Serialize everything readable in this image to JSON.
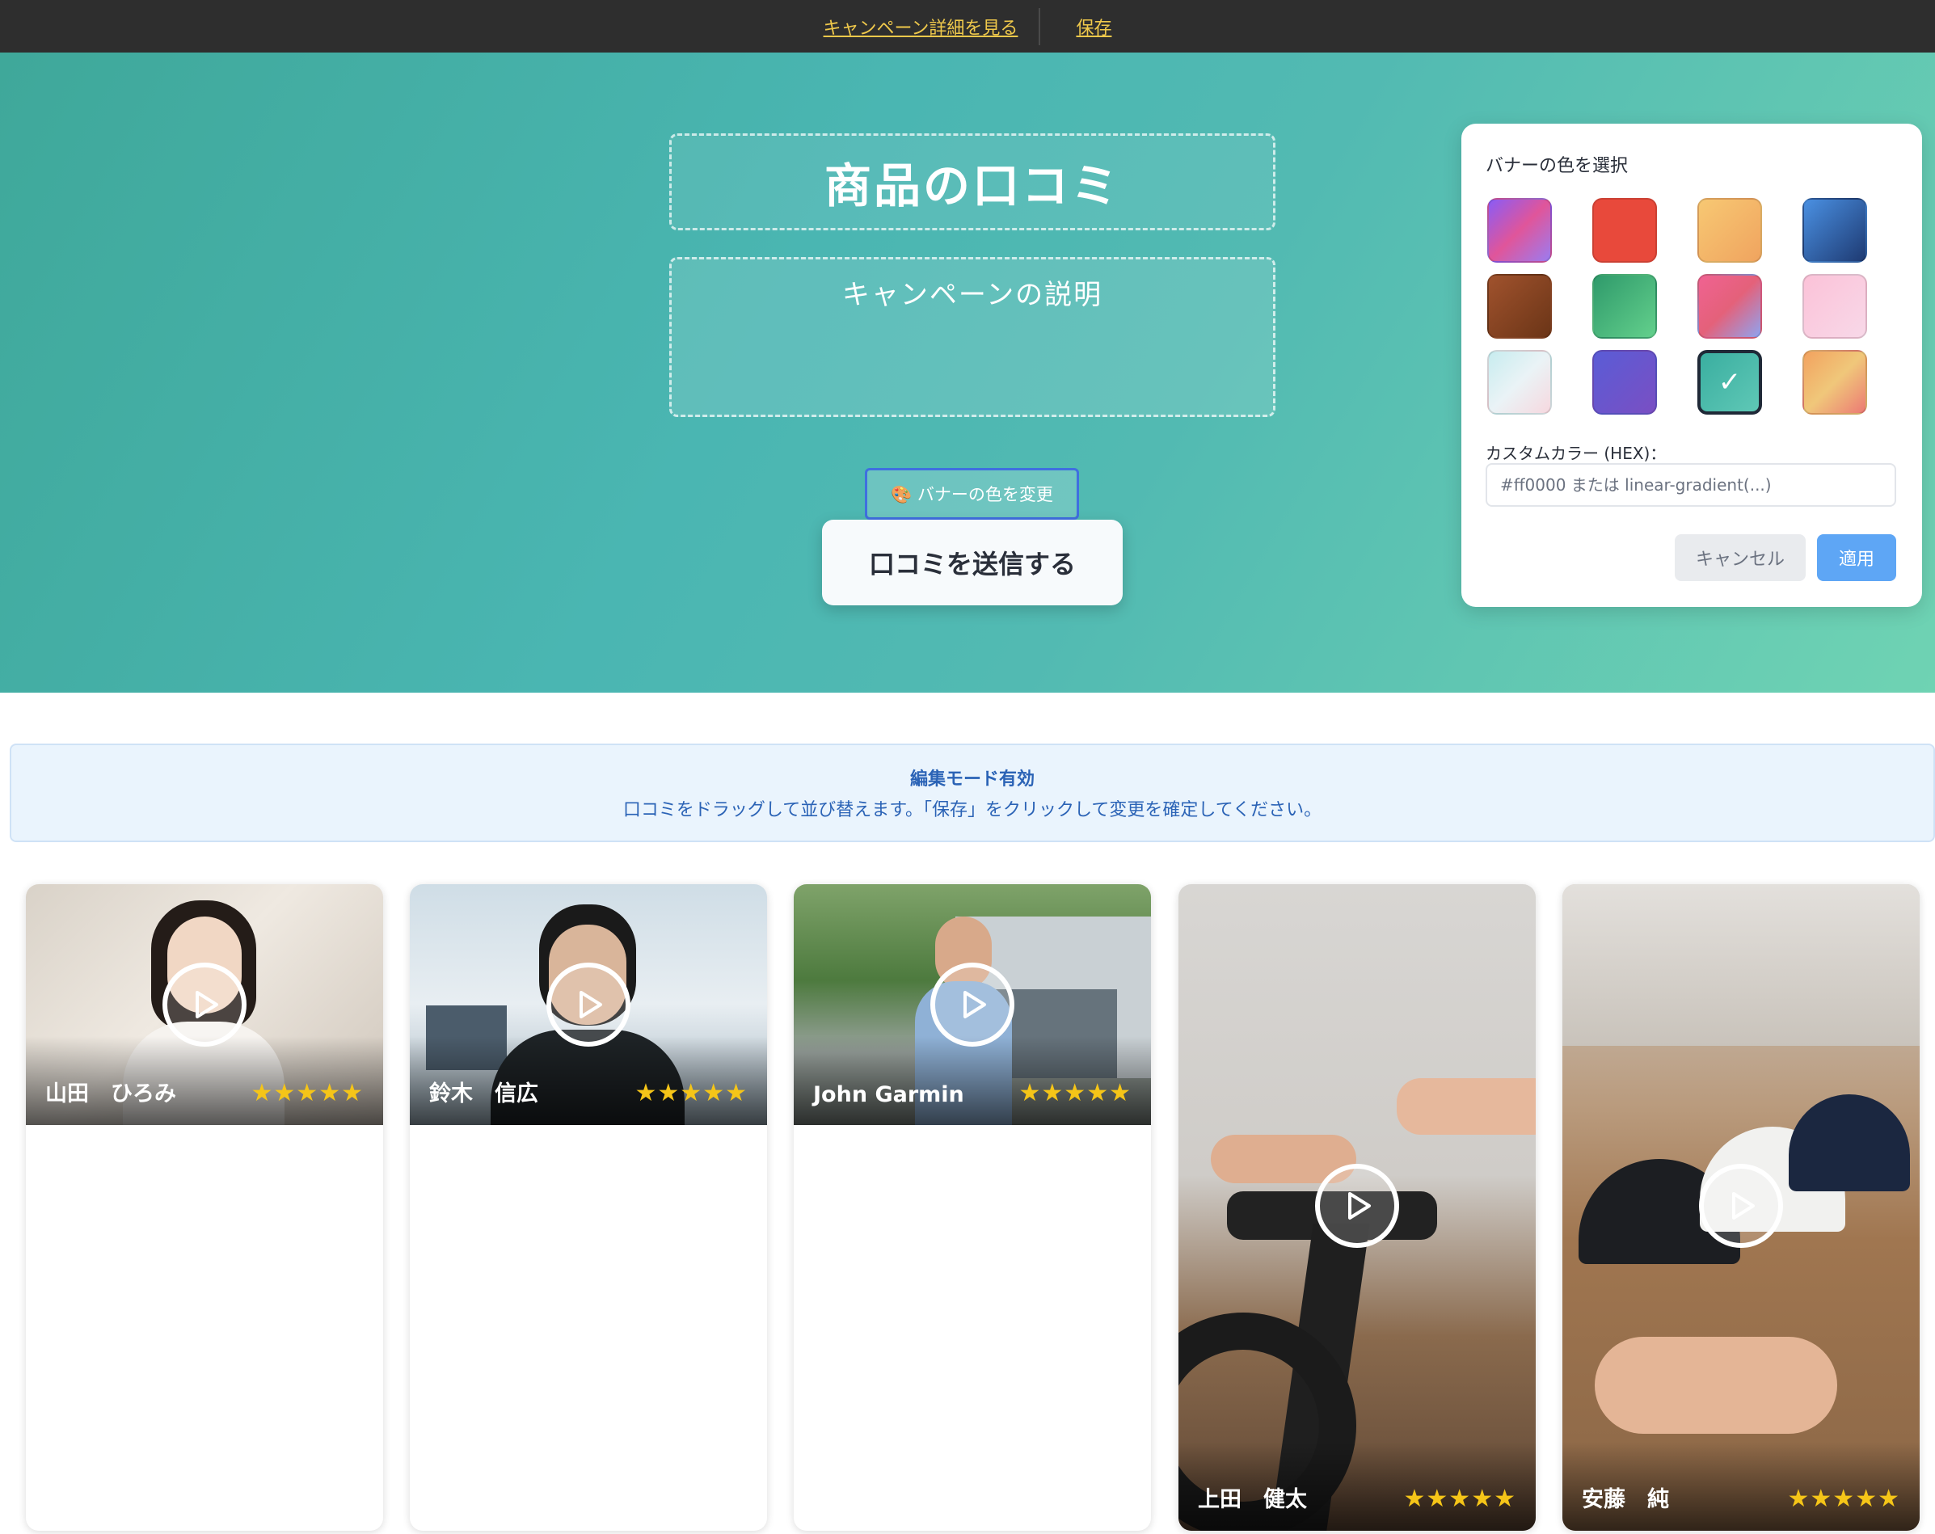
{
  "topbar": {
    "campaign_link": "キャンペーン詳細を見る",
    "save_link": "保存"
  },
  "banner": {
    "title": "商品の口コミ",
    "description": "キャンペーンの説明",
    "change_color_label": "🎨 バナーの色を変更",
    "submit_label": "口コミを送信する"
  },
  "picker": {
    "title": "バナーの色を選択",
    "swatches": [
      {
        "name": "purple-pink",
        "color": "linear-gradient(135deg,#8a5cf6,#e0559a,#9b7cf0)"
      },
      {
        "name": "red",
        "color": "#e8493b"
      },
      {
        "name": "peach",
        "color": "linear-gradient(135deg,#f7c873,#f0a45f)"
      },
      {
        "name": "blue",
        "color": "linear-gradient(135deg,#4a90e2,#1e3a72)"
      },
      {
        "name": "brown",
        "color": "linear-gradient(135deg,#a0522d,#6b3517)"
      },
      {
        "name": "green",
        "color": "linear-gradient(135deg,#2f9a6b,#63d08c)"
      },
      {
        "name": "pink-blue",
        "color": "linear-gradient(135deg,#f06292,#e4617a,#8fa3f0)"
      },
      {
        "name": "light-pink",
        "color": "linear-gradient(135deg,#fbc2d8,#f8d8e8)"
      },
      {
        "name": "pale-cyan",
        "color": "linear-gradient(135deg,#c7ecef,#eaf3f6,#f6d8df)"
      },
      {
        "name": "indigo",
        "color": "linear-gradient(135deg,#5a5cd6,#7a4fc3)"
      },
      {
        "name": "teal-selected",
        "color": "linear-gradient(135deg,#3aaea0,#5fc8b6)"
      },
      {
        "name": "orange-pink",
        "color": "linear-gradient(135deg,#f2a25f,#f0c77a,#ec7a74)"
      }
    ],
    "selected_mark": "✓",
    "custom_label": "カスタムカラー (HEX)：",
    "custom_placeholder": "#ff0000 または linear-gradient(...)",
    "cancel_label": "キャンセル",
    "apply_label": "適用"
  },
  "notice": {
    "title": "編集モード有効",
    "text": "口コミをドラッグして並び替えます。「保存」をクリックして変更を確定してください。"
  },
  "reviews": [
    {
      "name": "山田　ひろみ",
      "rating": 5,
      "stars": "★★★★★"
    },
    {
      "name": "鈴木　信広",
      "rating": 5,
      "stars": "★★★★★"
    },
    {
      "name": "John Garmin",
      "rating": 5,
      "stars": "★★★★★"
    },
    {
      "name": "上田　健太",
      "rating": 5,
      "stars": "★★★★★"
    },
    {
      "name": "安藤　純",
      "rating": 5,
      "stars": "★★★★★"
    }
  ]
}
